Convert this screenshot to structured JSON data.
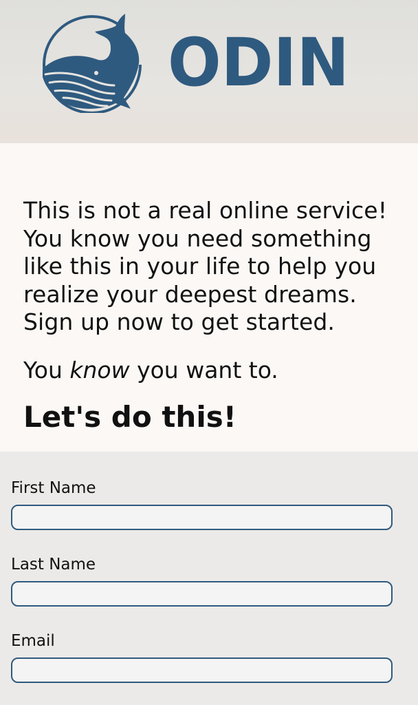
{
  "brand": {
    "name": "ODIN",
    "color": "#2f5a7f",
    "logo_icon": "whale-icon"
  },
  "intro": {
    "paragraph": "This is not a real online service! You know you need something like this in your life to help you realize your deepest dreams. Sign up now to get started.",
    "know_prefix": "You ",
    "know_emphasis": "know",
    "know_suffix": " you want to.",
    "cta_heading": "Let's do this!"
  },
  "form": {
    "fields": [
      {
        "label": "First Name",
        "value": "",
        "placeholder": ""
      },
      {
        "label": "Last Name",
        "value": "",
        "placeholder": ""
      },
      {
        "label": "Email",
        "value": "",
        "placeholder": ""
      }
    ]
  }
}
